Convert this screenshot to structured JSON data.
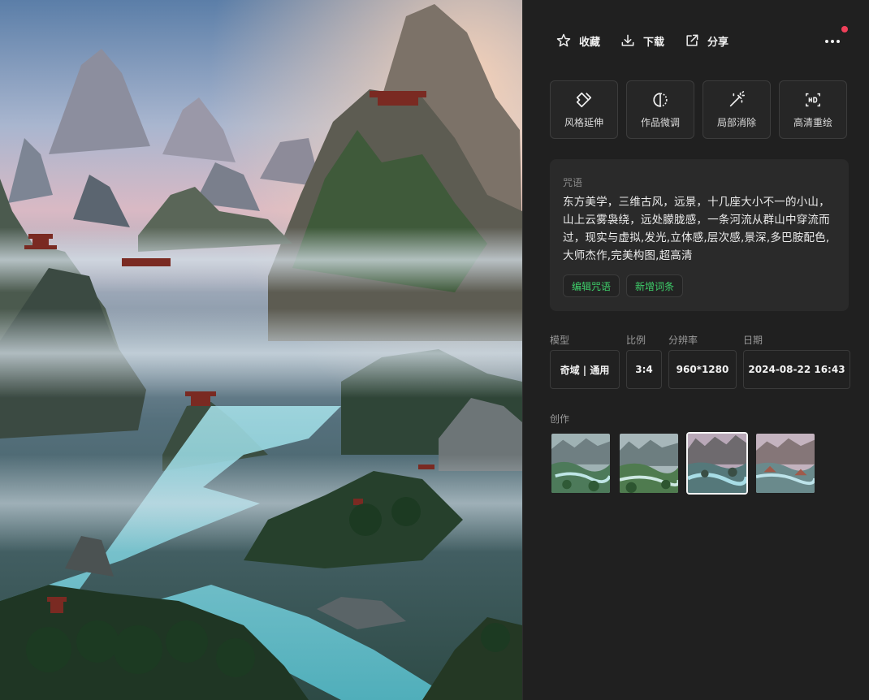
{
  "toolbar": {
    "favorite_label": "收藏",
    "download_label": "下载",
    "share_label": "分享",
    "favorite_icon": "star-icon",
    "download_icon": "download-icon",
    "share_icon": "share-icon",
    "more_icon": "more-dots-icon",
    "notification_color": "#f0405a"
  },
  "tools": [
    {
      "label": "风格延伸",
      "icon": "style-extend-icon"
    },
    {
      "label": "作品微调",
      "icon": "fine-tune-icon"
    },
    {
      "label": "局部消除",
      "icon": "magic-eraser-icon"
    },
    {
      "label": "高清重绘",
      "icon": "hd-icon"
    }
  ],
  "prompt": {
    "label": "咒语",
    "text": "东方美学，三维古风，远景，十几座大小不一的小山，山上云雾袅绕，远处朦胧感，一条河流从群山中穿流而过，现实与虚拟,发光,立体感,层次感,景深,多巴胺配色,大师杰作,完美构图,超高清",
    "edit_label": "编辑咒语",
    "add_label": "新增词条",
    "accent_color": "#3ecf6a"
  },
  "meta": {
    "model_label": "模型",
    "model_value": "奇域 | 通用",
    "ratio_label": "比例",
    "ratio_value": "3:4",
    "resolution_label": "分辨率",
    "resolution_value": "960*1280",
    "date_label": "日期",
    "date_value": "2024-08-22 16:43"
  },
  "creations": {
    "label": "创作",
    "selected_index": 2
  }
}
